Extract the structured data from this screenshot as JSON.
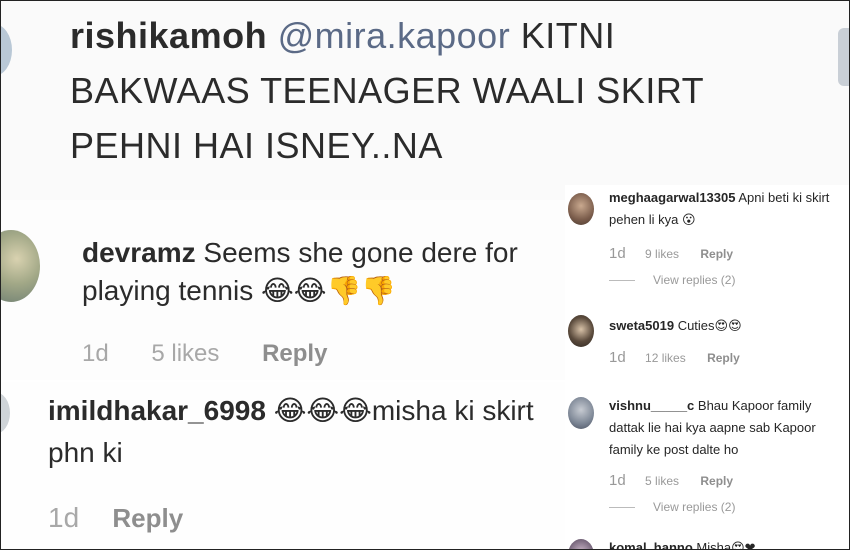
{
  "panel1": {
    "username": "rishikamoh",
    "mention": "@mira.kapoor",
    "text": "KITNI BAKWAAS TEENAGER WAALI SKIRT PEHNI HAI ISNEY..NA"
  },
  "panel2": {
    "username": "devramz",
    "text": "Seems she gone dere for playing tennis",
    "emojis": "😂😂👎👎",
    "time": "1d",
    "likes": "5 likes",
    "reply": "Reply"
  },
  "panel3": {
    "username": "imildhakar_6998",
    "emojis": "😂😂😂",
    "text": "misha ki skirt phn ki",
    "time": "1d",
    "reply": "Reply"
  },
  "right_comments": [
    {
      "username": "meghaagarwal13305",
      "text": "Apni beti ki skirt pehen li kya",
      "emoji": "😮",
      "time": "1d",
      "likes": "9 likes",
      "reply": "Reply",
      "view_replies": "View replies (2)"
    },
    {
      "username": "sweta5019",
      "text": "Cuties",
      "emoji": "😍😍",
      "time": "1d",
      "likes": "12 likes",
      "reply": "Reply"
    },
    {
      "username": "vishnu_____c",
      "text": "Bhau Kapoor family dattak lie hai kya aapne sab Kapoor family ke post dalte ho",
      "time": "1d",
      "likes": "5 likes",
      "reply": "Reply",
      "view_replies": "View replies (2)"
    },
    {
      "username": "komal_hanno",
      "text": "Misha",
      "emoji": "😍❤"
    }
  ],
  "colors": {
    "mention": "#5b6a86",
    "muted": "#a8a8a8",
    "text": "#262626"
  }
}
